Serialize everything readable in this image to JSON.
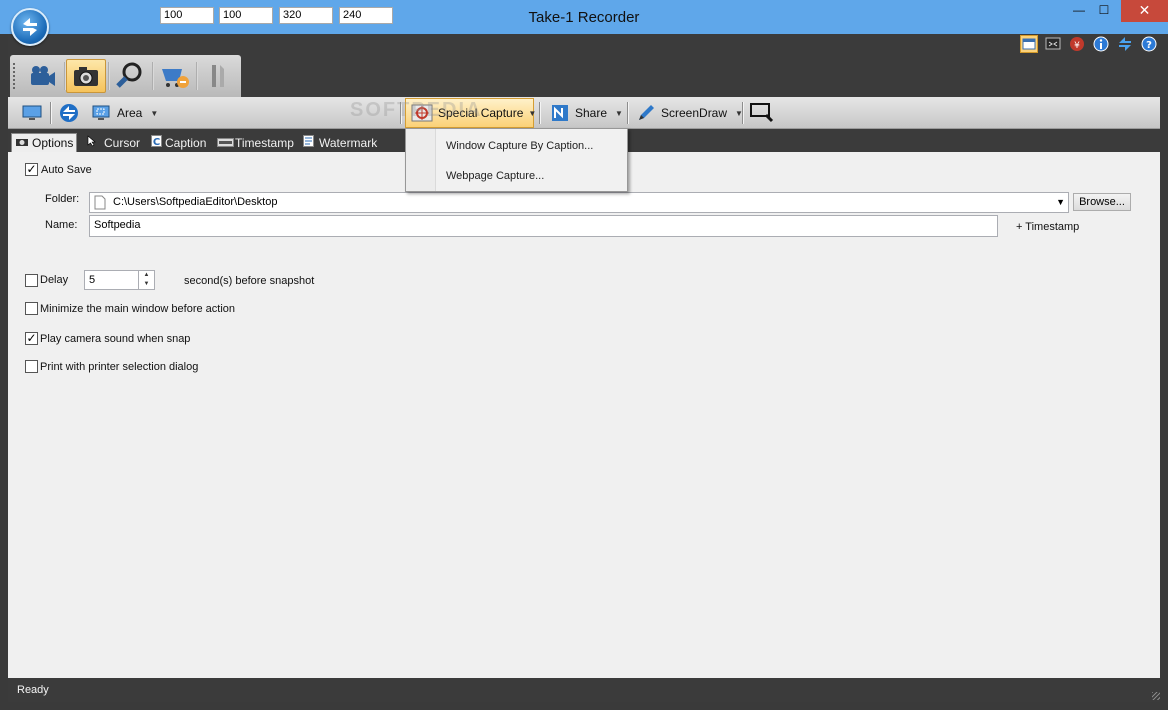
{
  "window": {
    "title": "Take-1 Recorder",
    "minimize": "—",
    "maximize": "☐",
    "close": "✕"
  },
  "toolbar": {
    "area_label": "Area",
    "area_x": "100",
    "area_y": "100",
    "area_w": "320",
    "area_h": "240",
    "special_capture_label": "Special Capture",
    "share_label": "Share",
    "screendraw_label": "ScreenDraw"
  },
  "special_menu": {
    "items": [
      "Window Capture By Caption...",
      "Webpage Capture..."
    ]
  },
  "subtabs": [
    "Options",
    "Cursor",
    "Caption",
    "Timestamp",
    "Watermark"
  ],
  "options": {
    "auto_save_label": "Auto Save",
    "auto_save_checked": true,
    "folder_label": "Folder:",
    "folder_value": "C:\\Users\\SoftpediaEditor\\Desktop",
    "browse_label": "Browse...",
    "name_label": "Name:",
    "name_value": "Softpedia",
    "add_timestamp_label": "+ Timestamp",
    "delay_label": "Delay",
    "delay_checked": false,
    "delay_value": "5",
    "delay_suffix": "second(s) before snapshot",
    "minimize_label": "Minimize the main window before action",
    "minimize_checked": false,
    "camera_sound_label": "Play camera sound when snap",
    "camera_sound_checked": true,
    "print_label": "Print with printer selection dialog",
    "print_checked": false
  },
  "status": {
    "text": "Ready"
  },
  "watermark_text": "SOFTPEDIA",
  "colors": {
    "titlebar": "#5fa7ea",
    "frame": "#3b3b3b",
    "active_button": "#fbd177",
    "close_button": "#c7493b"
  }
}
